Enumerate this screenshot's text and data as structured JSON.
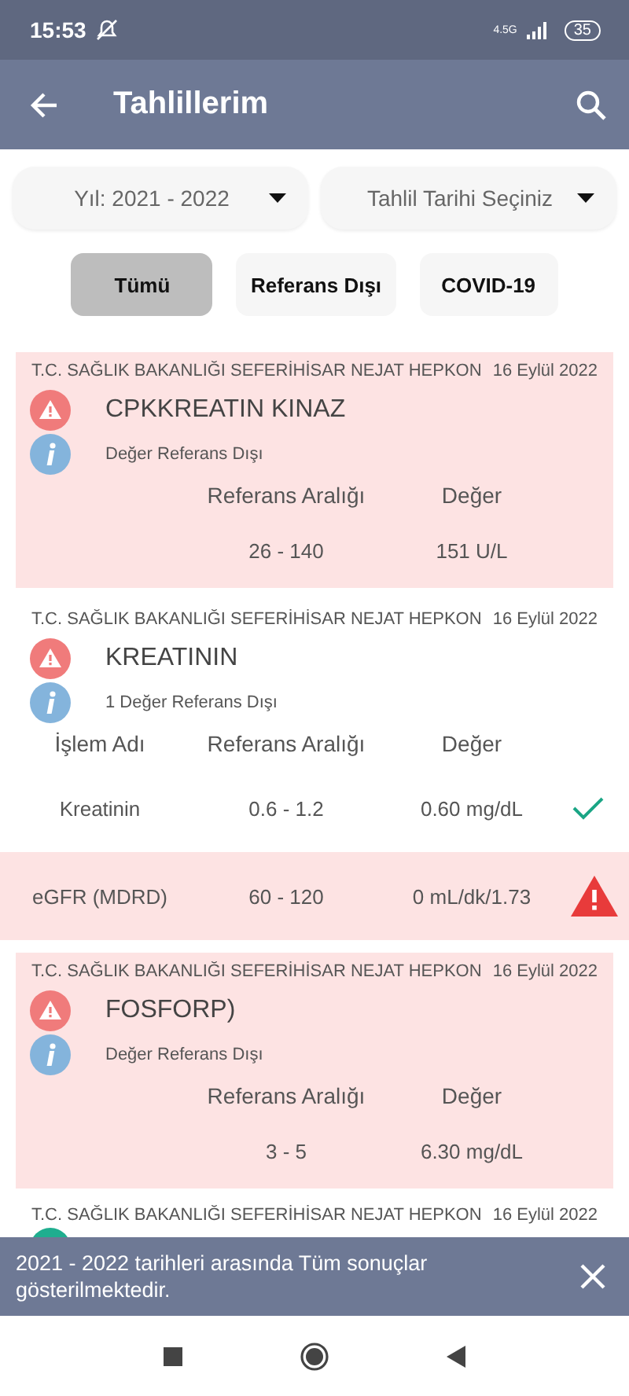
{
  "status_bar": {
    "time": "15:53",
    "network": "4.5G",
    "battery": "35"
  },
  "app_bar": {
    "title": "Tahlillerim"
  },
  "filters": [
    {
      "label": "Yıl: 2021 - 2022"
    },
    {
      "label": "Tahlil Tarihi Seçiniz"
    }
  ],
  "chips": [
    {
      "label": "Tümü",
      "selected": true
    },
    {
      "label": "Referans Dışı",
      "selected": false
    },
    {
      "label": "COVID-19",
      "selected": false
    }
  ],
  "results": [
    {
      "kind": "out_of_range",
      "hospital": "T.C. SAĞLIK BAKANLIĞI SEFERİHİSAR NEJAT HEPKON",
      "date": "16 Eylül 2022",
      "title": "CPKKREATIN KINAZ",
      "note": "Değer Referans Dışı",
      "columns": [
        "",
        "Referans Aralığı",
        "Değer"
      ],
      "rows": [
        {
          "name": "",
          "range": "26 - 140",
          "value": "151 U/L",
          "kind": "plain"
        }
      ]
    },
    {
      "kind": "normal",
      "hospital": "T.C. SAĞLIK BAKANLIĞI SEFERİHİSAR NEJAT HEPKON",
      "date": "16 Eylül 2022",
      "title": "KREATININ",
      "note": "1 Değer Referans Dışı",
      "columns": [
        "İşlem Adı",
        "Referans Aralığı",
        "Değer"
      ],
      "rows": [
        {
          "name": "Kreatinin",
          "range": "0.6 - 1.2",
          "value": "0.60 mg/dL",
          "kind": "ok"
        },
        {
          "name": "eGFR (MDRD)",
          "range": "60 - 120",
          "value": "0 mL/dk/1.73",
          "kind": "out"
        }
      ]
    },
    {
      "kind": "out_of_range",
      "hospital": "T.C. SAĞLIK BAKANLIĞI SEFERİHİSAR NEJAT HEPKON",
      "date": "16 Eylül 2022",
      "title": "FOSFORP)",
      "note": "Değer Referans Dışı",
      "columns": [
        "",
        "Referans Aralığı",
        "Değer"
      ],
      "rows": [
        {
          "name": "",
          "range": "3 - 5",
          "value": "6.30 mg/dL",
          "kind": "plain"
        }
      ]
    },
    {
      "kind": "partial",
      "hospital": "T.C. SAĞLIK BAKANLIĞI SEFERİHİSAR NEJAT HEPKON",
      "date": "16 Eylül 2022"
    }
  ],
  "snackbar": {
    "message": "2021 - 2022 tarihleri arasında Tüm sonuçlar gösterilmektedir."
  }
}
